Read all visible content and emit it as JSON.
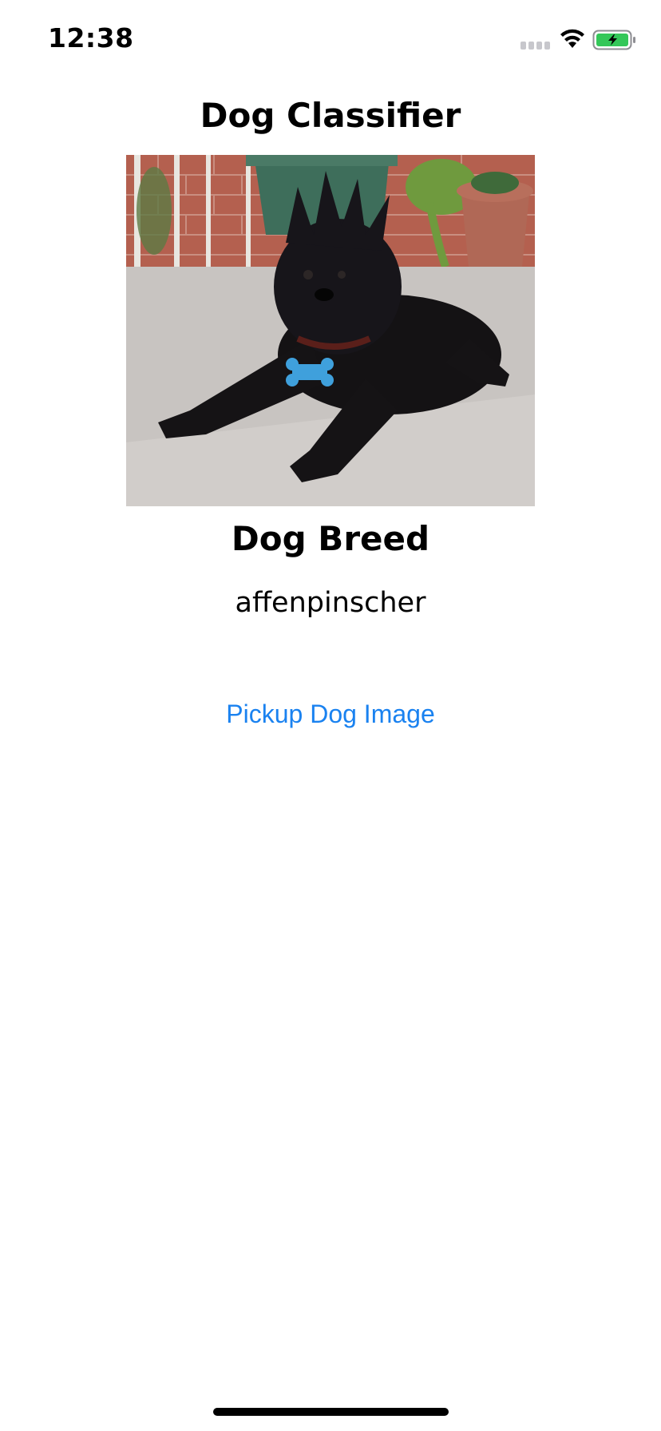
{
  "status_bar": {
    "time": "12:38",
    "icons": [
      "cellular-signal-icon",
      "wifi-icon",
      "battery-charging-icon"
    ],
    "battery_color": "#34c759"
  },
  "app": {
    "title": "Dog Classifier",
    "image": {
      "subject": "dog-photo"
    },
    "result_heading": "Dog Breed",
    "result_value": "affenpinscher",
    "pickup_button_label": "Pickup Dog Image",
    "accent_color": "#1a82f0"
  }
}
